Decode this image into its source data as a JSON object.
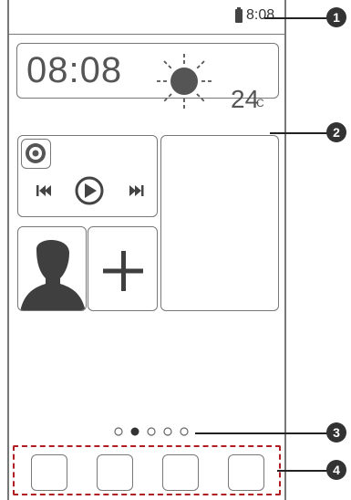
{
  "status_bar": {
    "time": "8:08",
    "battery_icon": "battery-icon"
  },
  "clock_widget": {
    "time": "08:08",
    "weather_icon": "sun-icon",
    "temperature": "24",
    "unit": "C"
  },
  "music_widget": {
    "album_icon": "disc-icon",
    "controls": [
      "previous-track-icon",
      "play-icon",
      "next-track-icon"
    ]
  },
  "contact_widget": {
    "icon": "person-silhouette-icon"
  },
  "add_widget": {
    "icon": "plus-icon"
  },
  "page_indicator": {
    "total": 5,
    "active_index": 1
  },
  "dock": {
    "slot_count": 4
  },
  "callouts": [
    "1",
    "2",
    "3",
    "4"
  ],
  "colors": {
    "outline": "#777777",
    "dock_border": "#b01e23",
    "callout_fill": "#333333",
    "icon_fill": "#444444"
  }
}
